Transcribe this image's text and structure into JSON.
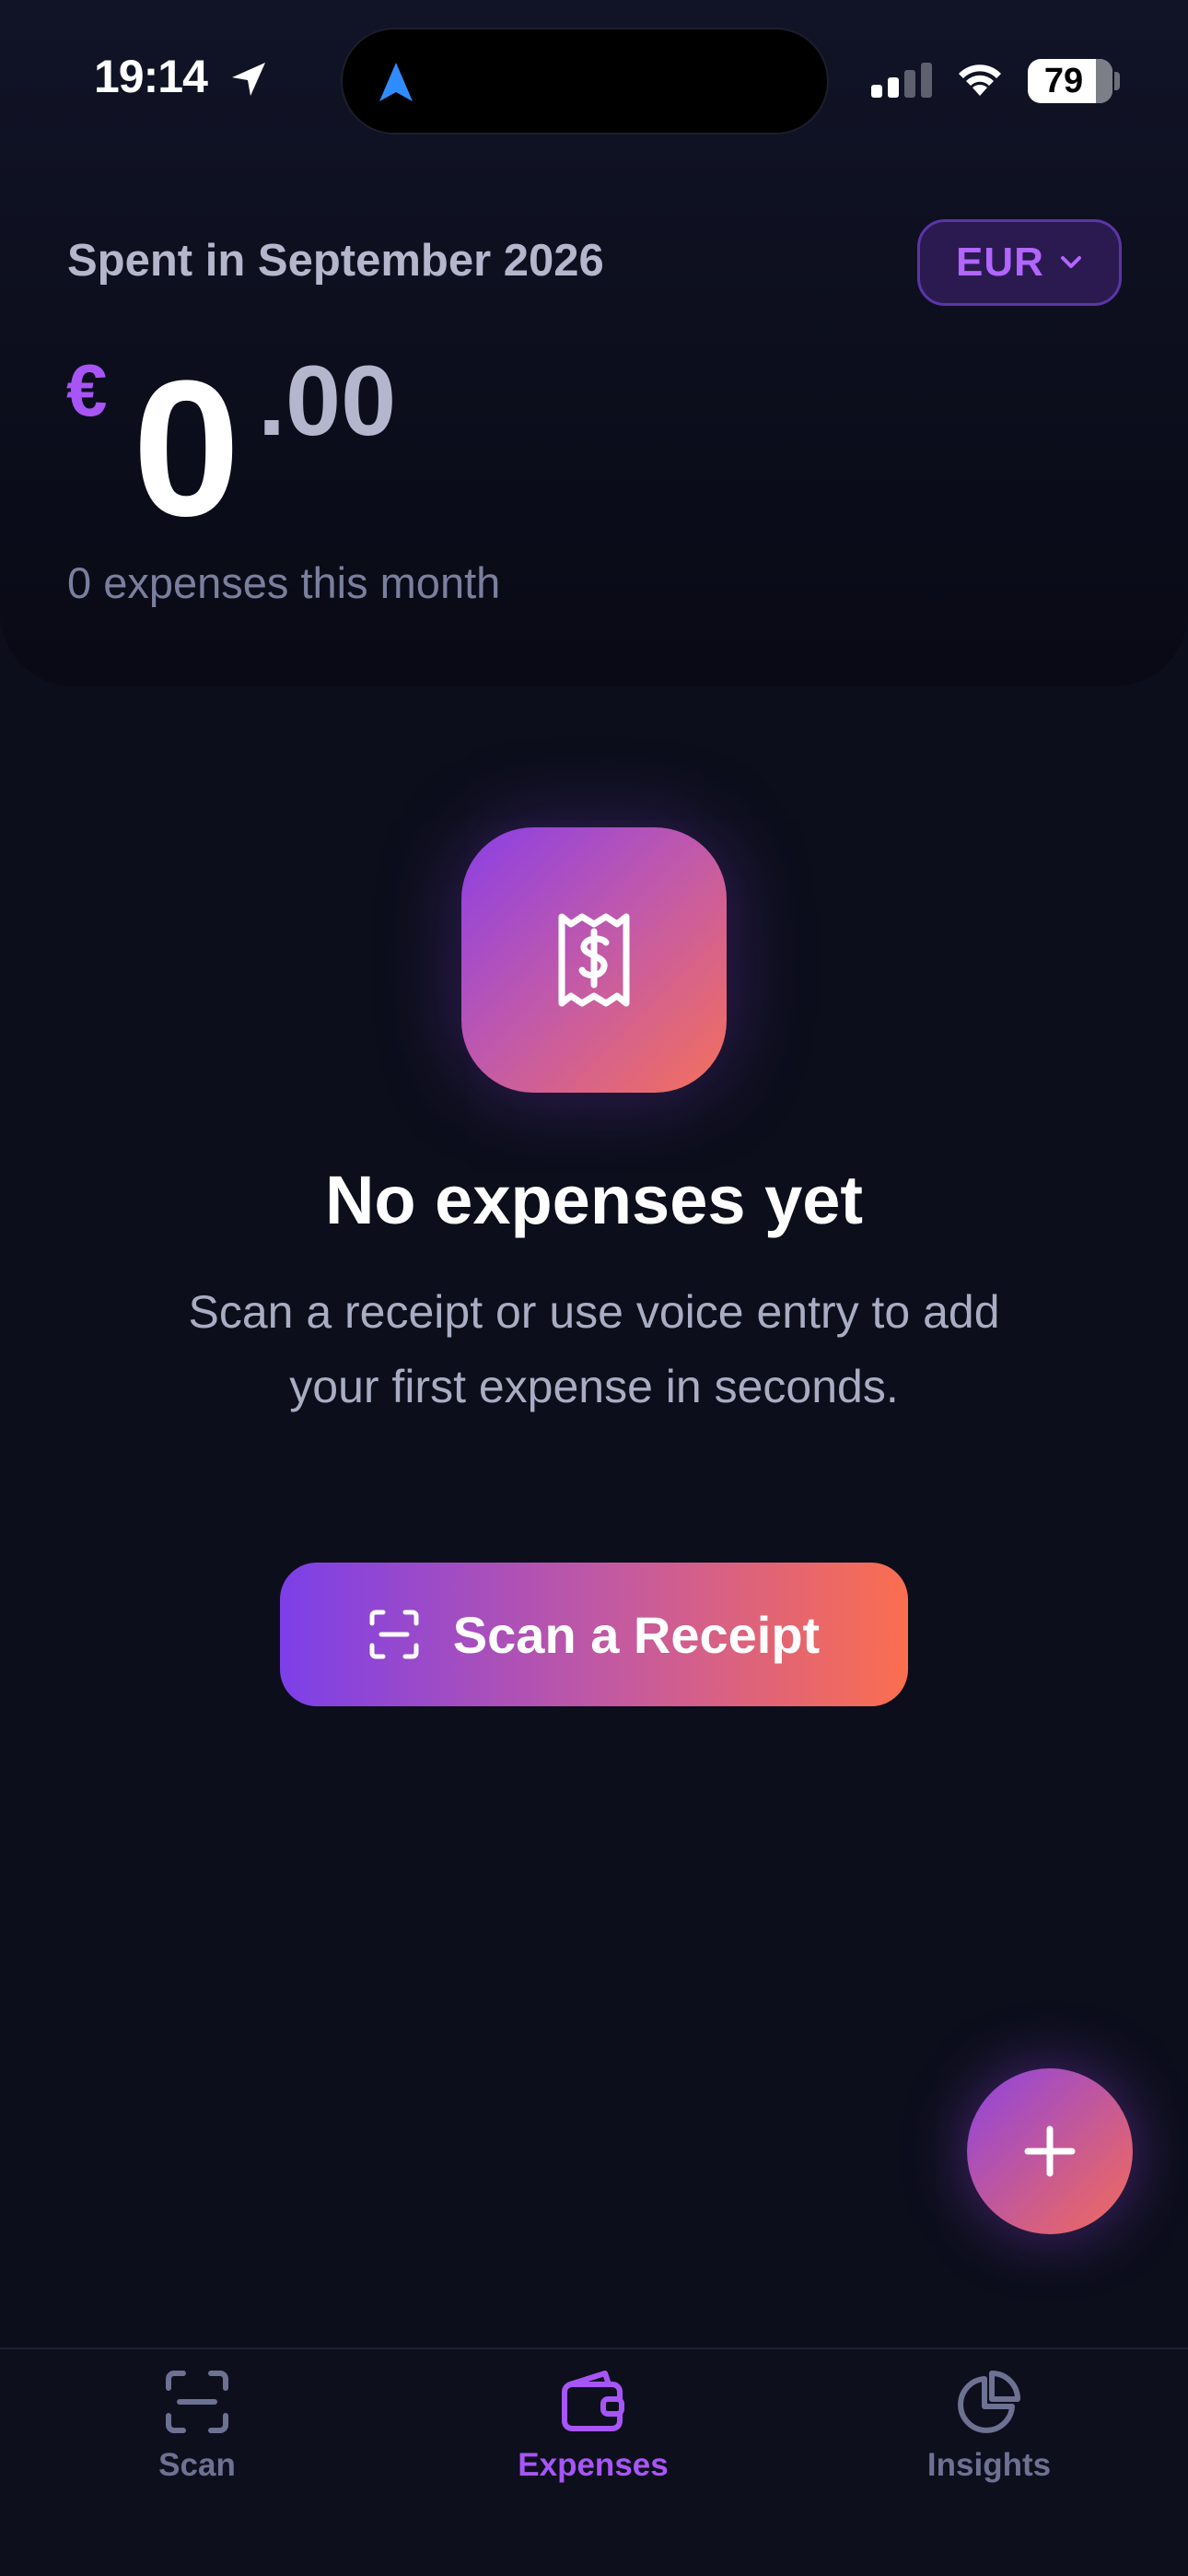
{
  "status_bar": {
    "time": "19:14",
    "battery": "79"
  },
  "summary": {
    "label": "Spent in September 2026",
    "currency_code": "EUR",
    "currency_symbol": "€",
    "amount_integer": "0",
    "amount_decimal": ".00",
    "expense_count_text": "0 expenses this month"
  },
  "empty_state": {
    "title": "No expenses yet",
    "description": "Scan a receipt or use voice entry to add your first expense in seconds.",
    "button_label": "Scan a Receipt"
  },
  "tabs": [
    {
      "label": "Scan",
      "icon": "scan-icon",
      "active": false
    },
    {
      "label": "Expenses",
      "icon": "wallet-icon",
      "active": true
    },
    {
      "label": "Insights",
      "icon": "pie-chart-icon",
      "active": false
    }
  ],
  "colors": {
    "accent": "#a855f7",
    "gradient_start": "#7c3fe8",
    "gradient_end": "#fb6e4f",
    "background": "#0c0e1b"
  }
}
